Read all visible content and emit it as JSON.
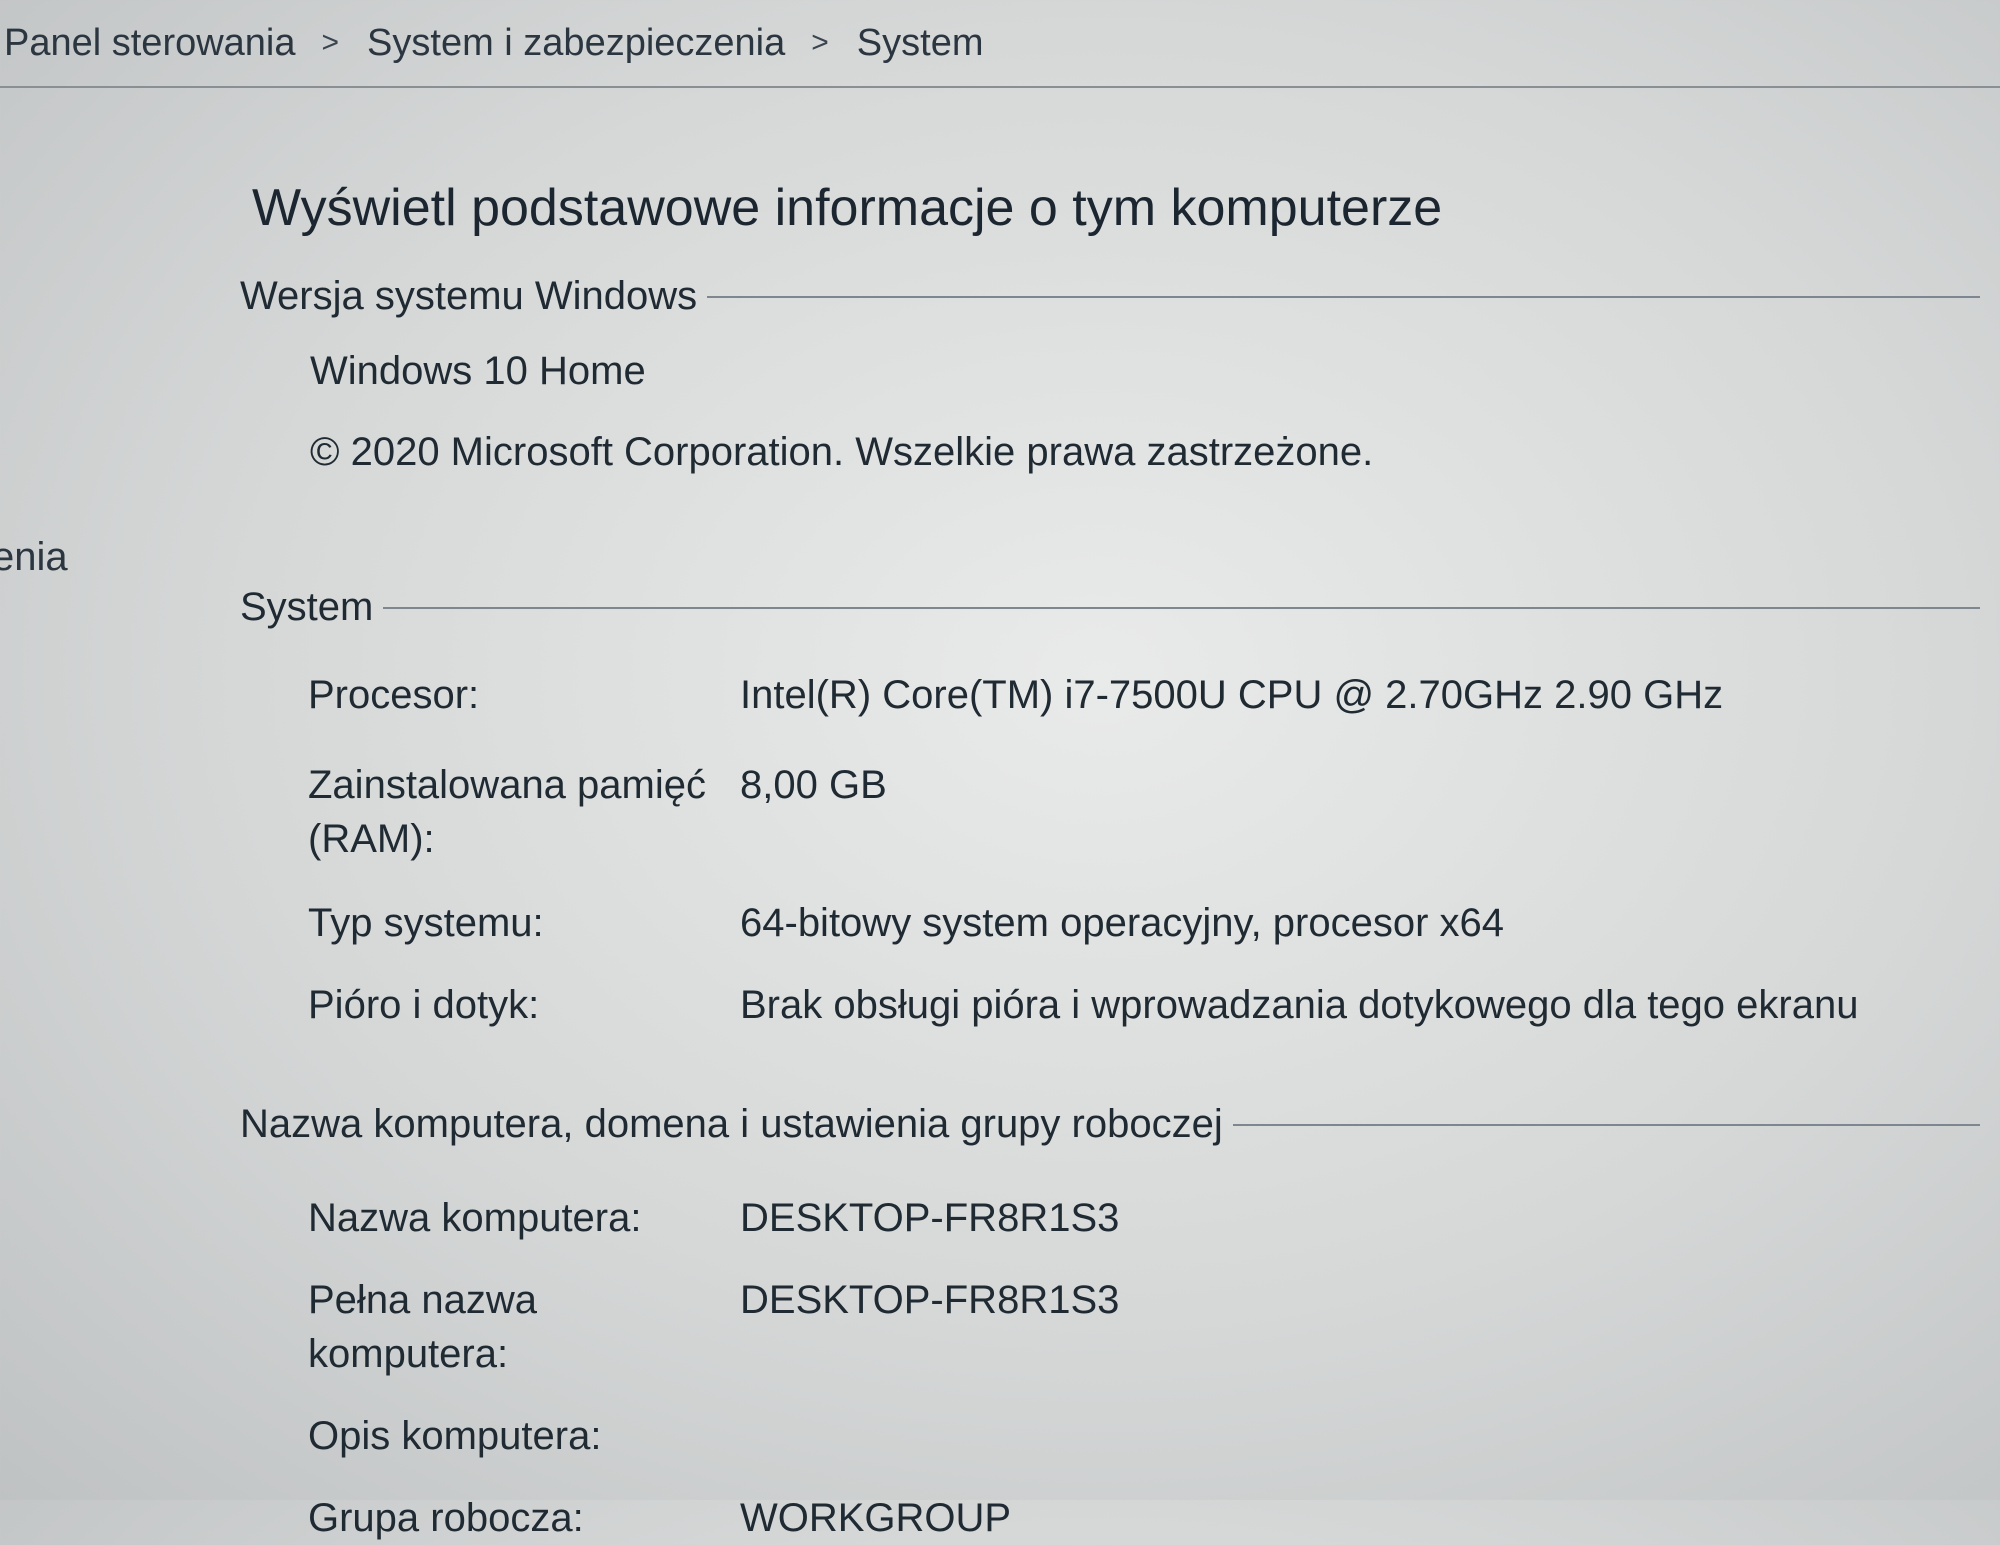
{
  "breadcrumb": {
    "items": [
      "Panel sterowania",
      "System i zabezpieczenia",
      "System"
    ],
    "separator": ">"
  },
  "sidebar_partial_text": "enia",
  "page_title": "Wyświetl podstawowe informacje o tym komputerze",
  "windows_section": {
    "heading": "Wersja systemu Windows",
    "edition": "Windows 10 Home",
    "copyright": "© 2020 Microsoft Corporation. Wszelkie prawa zastrzeżone."
  },
  "system_section": {
    "heading": "System",
    "rows": [
      {
        "label": "Procesor:",
        "value": "Intel(R) Core(TM) i7-7500U CPU @ 2.70GHz   2.90 GHz"
      },
      {
        "label": "Zainstalowana pamięć (RAM):",
        "value": "8,00 GB"
      },
      {
        "label": "Typ systemu:",
        "value": "64-bitowy system operacyjny, procesor x64"
      },
      {
        "label": "Pióro i dotyk:",
        "value": "Brak obsługi pióra i wprowadzania dotykowego dla tego ekranu"
      }
    ]
  },
  "computer_section": {
    "heading": "Nazwa komputera, domena i ustawienia grupy roboczej",
    "rows": [
      {
        "label": "Nazwa komputera:",
        "value": "DESKTOP-FR8R1S3"
      },
      {
        "label": "Pełna nazwa komputera:",
        "value": "DESKTOP-FR8R1S3"
      },
      {
        "label": "Opis komputera:",
        "value": ""
      },
      {
        "label": "Grupa robocza:",
        "value": "WORKGROUP"
      }
    ]
  }
}
